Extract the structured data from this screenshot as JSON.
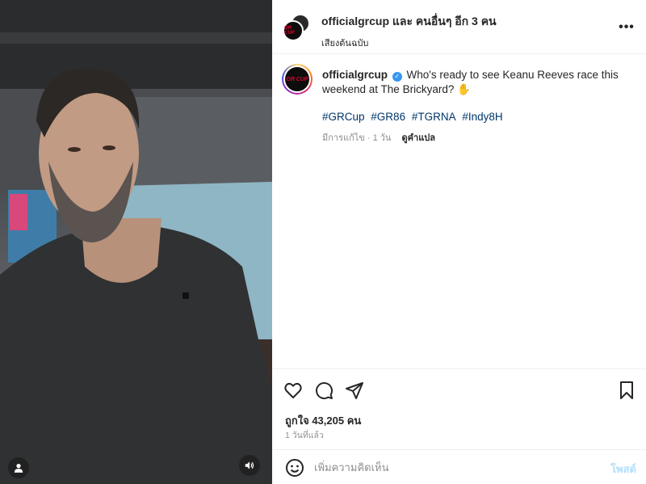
{
  "media": {
    "description_icons": {
      "tag": "person-tag-icon",
      "audio": "speaker-icon"
    }
  },
  "header": {
    "username": "officialgrcup",
    "and_others": "และ คนอื่นๆ อีก 3 คน",
    "audio_label": "เสียงต้นฉบับ",
    "more": "•••"
  },
  "caption": {
    "avatar_logo": "GR CUP",
    "username": "officialgrcup",
    "verified": "✓",
    "text": "Who's ready to see Keanu Reeves race this weekend at The Brickyard? ✋",
    "hashtags": [
      "#GRCup",
      "#GR86",
      "#TGRNA",
      "#Indy8H"
    ],
    "edited": "มีการแก้ไข · 1 วัน",
    "translate": "ดูคำแปล"
  },
  "actions": {
    "likes": "ถูกใจ 43,205 คน",
    "time_ago": "1 วันที่แล้ว"
  },
  "comment": {
    "placeholder": "เพิ่มความคิดเห็น",
    "post_label": "โพสต์"
  },
  "colors": {
    "link": "#00376b",
    "verified": "#3897f0",
    "post_disabled": "#b2dffc",
    "muted": "#8e8e8e"
  }
}
